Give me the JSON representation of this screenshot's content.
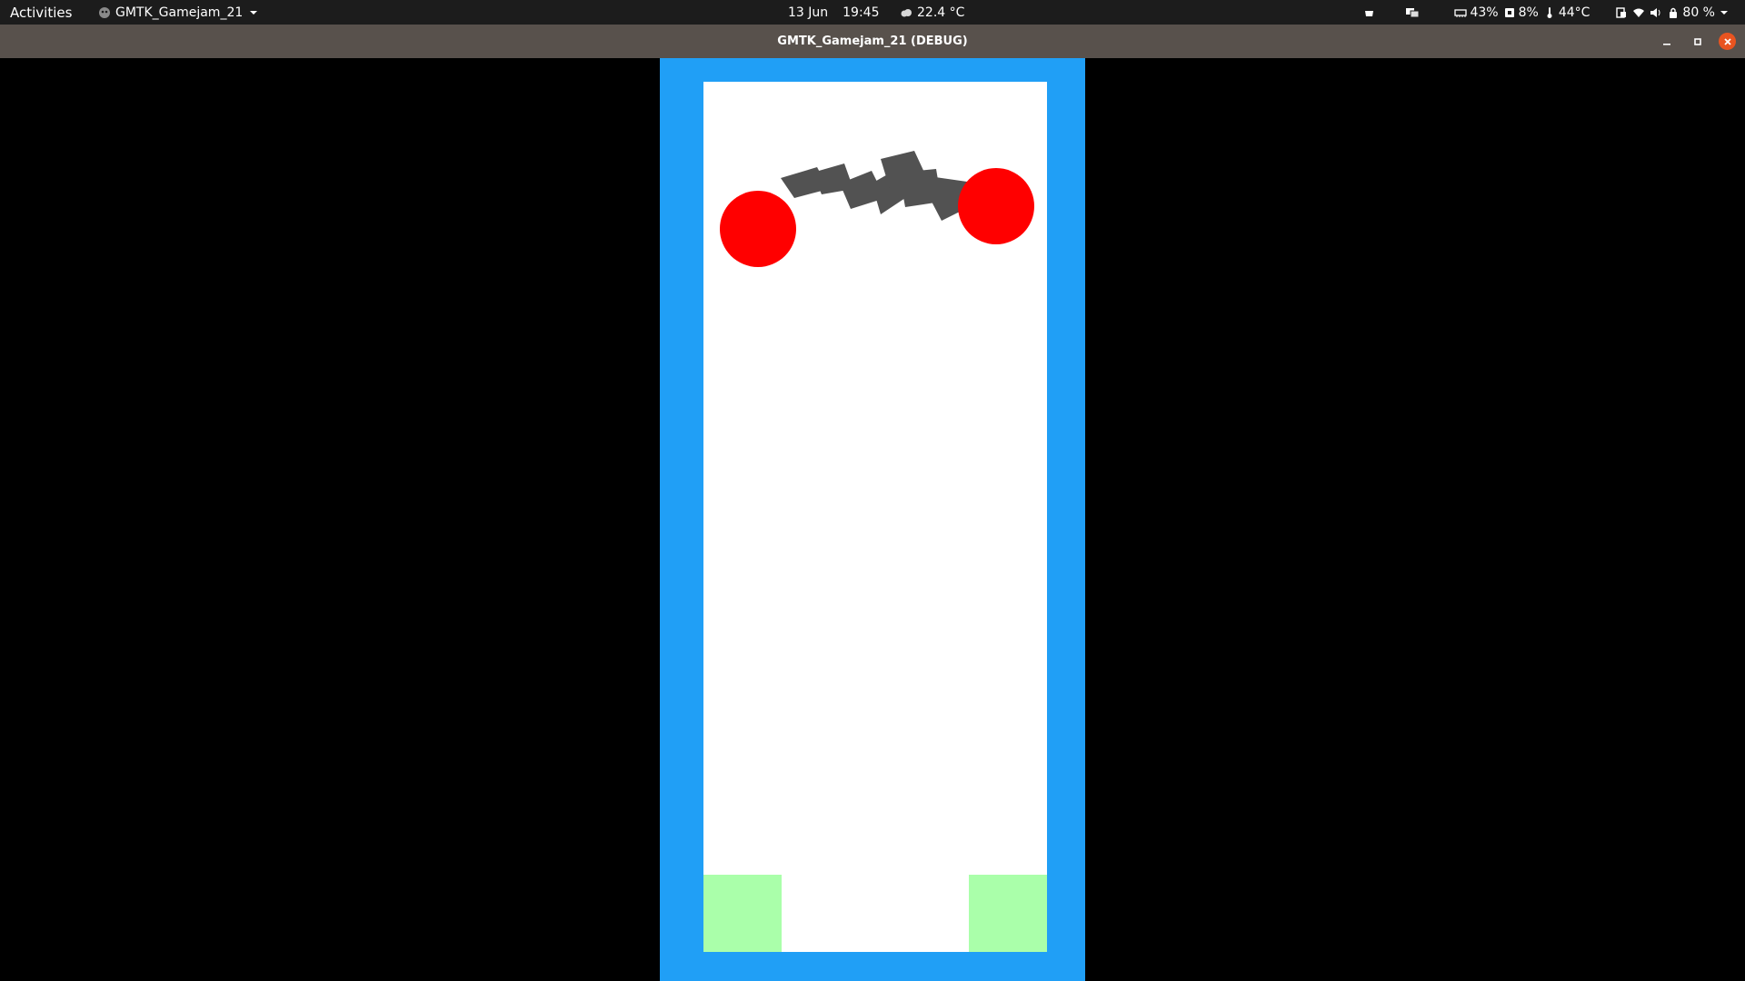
{
  "topbar": {
    "activities": "Activities",
    "app_name": "GMTK_Gamejam_21",
    "date": "13 Jun",
    "time": "19:45",
    "weather": "22.4 °C",
    "memory": "43%",
    "cpu": "8%",
    "temperature": "44°C",
    "battery": "80 %"
  },
  "window": {
    "title": "GMTK_Gamejam_21 (DEBUG)"
  },
  "game": {
    "colors": {
      "frame": "#209ff6",
      "play_area": "#ffffff",
      "ball": "#ff0000",
      "rope": "#525252",
      "goal": "#aaffaa"
    },
    "balls": [
      "ball-left",
      "ball-right"
    ],
    "goals": [
      "goal-left",
      "goal-right"
    ],
    "rope_segments": 7
  }
}
